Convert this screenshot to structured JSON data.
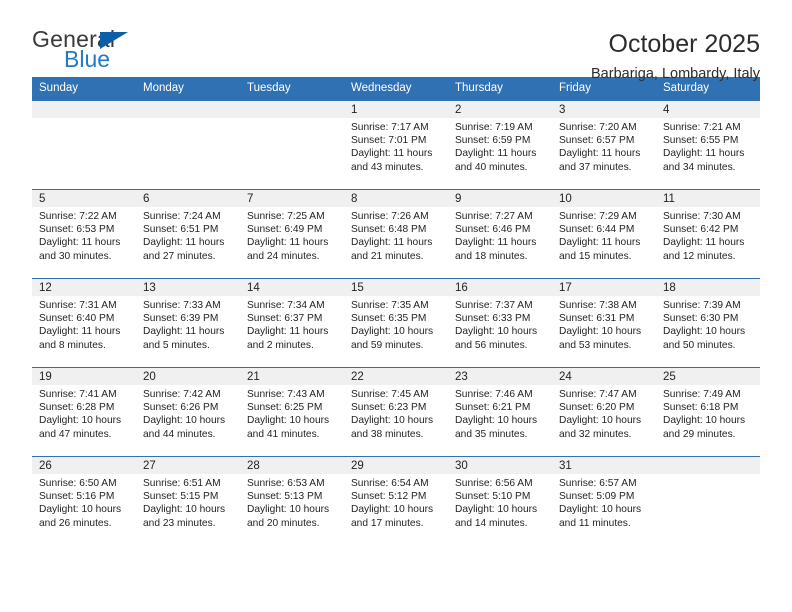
{
  "brand": {
    "name_part1": "General",
    "name_part2": "Blue",
    "triangle_icon": "triangle-icon",
    "accent_color": "#1f7ac8",
    "triangle_color": "#0b5ea8"
  },
  "header": {
    "title": "October 2025",
    "subtitle": "Barbariga, Lombardy, Italy"
  },
  "colors": {
    "header_blue": "#3071b4",
    "daynum_bg": "#f0f0f0",
    "text": "#231f20"
  },
  "weekday_headers": [
    "Sunday",
    "Monday",
    "Tuesday",
    "Wednesday",
    "Thursday",
    "Friday",
    "Saturday"
  ],
  "labels": {
    "sunrise_prefix": "Sunrise: ",
    "sunset_prefix": "Sunset: ",
    "daylight_prefix": "Daylight: "
  },
  "weeks": [
    [
      {
        "day": "",
        "empty": true
      },
      {
        "day": "",
        "empty": true
      },
      {
        "day": "",
        "empty": true
      },
      {
        "day": "1",
        "sunrise": "Sunrise: 7:17 AM",
        "sunset": "Sunset: 7:01 PM",
        "daylight_line1": "Daylight: 11 hours",
        "daylight_line2": "and 43 minutes."
      },
      {
        "day": "2",
        "sunrise": "Sunrise: 7:19 AM",
        "sunset": "Sunset: 6:59 PM",
        "daylight_line1": "Daylight: 11 hours",
        "daylight_line2": "and 40 minutes."
      },
      {
        "day": "3",
        "sunrise": "Sunrise: 7:20 AM",
        "sunset": "Sunset: 6:57 PM",
        "daylight_line1": "Daylight: 11 hours",
        "daylight_line2": "and 37 minutes."
      },
      {
        "day": "4",
        "sunrise": "Sunrise: 7:21 AM",
        "sunset": "Sunset: 6:55 PM",
        "daylight_line1": "Daylight: 11 hours",
        "daylight_line2": "and 34 minutes."
      }
    ],
    [
      {
        "day": "5",
        "sunrise": "Sunrise: 7:22 AM",
        "sunset": "Sunset: 6:53 PM",
        "daylight_line1": "Daylight: 11 hours",
        "daylight_line2": "and 30 minutes."
      },
      {
        "day": "6",
        "sunrise": "Sunrise: 7:24 AM",
        "sunset": "Sunset: 6:51 PM",
        "daylight_line1": "Daylight: 11 hours",
        "daylight_line2": "and 27 minutes."
      },
      {
        "day": "7",
        "sunrise": "Sunrise: 7:25 AM",
        "sunset": "Sunset: 6:49 PM",
        "daylight_line1": "Daylight: 11 hours",
        "daylight_line2": "and 24 minutes."
      },
      {
        "day": "8",
        "sunrise": "Sunrise: 7:26 AM",
        "sunset": "Sunset: 6:48 PM",
        "daylight_line1": "Daylight: 11 hours",
        "daylight_line2": "and 21 minutes."
      },
      {
        "day": "9",
        "sunrise": "Sunrise: 7:27 AM",
        "sunset": "Sunset: 6:46 PM",
        "daylight_line1": "Daylight: 11 hours",
        "daylight_line2": "and 18 minutes."
      },
      {
        "day": "10",
        "sunrise": "Sunrise: 7:29 AM",
        "sunset": "Sunset: 6:44 PM",
        "daylight_line1": "Daylight: 11 hours",
        "daylight_line2": "and 15 minutes."
      },
      {
        "day": "11",
        "sunrise": "Sunrise: 7:30 AM",
        "sunset": "Sunset: 6:42 PM",
        "daylight_line1": "Daylight: 11 hours",
        "daylight_line2": "and 12 minutes."
      }
    ],
    [
      {
        "day": "12",
        "sunrise": "Sunrise: 7:31 AM",
        "sunset": "Sunset: 6:40 PM",
        "daylight_line1": "Daylight: 11 hours",
        "daylight_line2": "and 8 minutes."
      },
      {
        "day": "13",
        "sunrise": "Sunrise: 7:33 AM",
        "sunset": "Sunset: 6:39 PM",
        "daylight_line1": "Daylight: 11 hours",
        "daylight_line2": "and 5 minutes."
      },
      {
        "day": "14",
        "sunrise": "Sunrise: 7:34 AM",
        "sunset": "Sunset: 6:37 PM",
        "daylight_line1": "Daylight: 11 hours",
        "daylight_line2": "and 2 minutes."
      },
      {
        "day": "15",
        "sunrise": "Sunrise: 7:35 AM",
        "sunset": "Sunset: 6:35 PM",
        "daylight_line1": "Daylight: 10 hours",
        "daylight_line2": "and 59 minutes."
      },
      {
        "day": "16",
        "sunrise": "Sunrise: 7:37 AM",
        "sunset": "Sunset: 6:33 PM",
        "daylight_line1": "Daylight: 10 hours",
        "daylight_line2": "and 56 minutes."
      },
      {
        "day": "17",
        "sunrise": "Sunrise: 7:38 AM",
        "sunset": "Sunset: 6:31 PM",
        "daylight_line1": "Daylight: 10 hours",
        "daylight_line2": "and 53 minutes."
      },
      {
        "day": "18",
        "sunrise": "Sunrise: 7:39 AM",
        "sunset": "Sunset: 6:30 PM",
        "daylight_line1": "Daylight: 10 hours",
        "daylight_line2": "and 50 minutes."
      }
    ],
    [
      {
        "day": "19",
        "sunrise": "Sunrise: 7:41 AM",
        "sunset": "Sunset: 6:28 PM",
        "daylight_line1": "Daylight: 10 hours",
        "daylight_line2": "and 47 minutes."
      },
      {
        "day": "20",
        "sunrise": "Sunrise: 7:42 AM",
        "sunset": "Sunset: 6:26 PM",
        "daylight_line1": "Daylight: 10 hours",
        "daylight_line2": "and 44 minutes."
      },
      {
        "day": "21",
        "sunrise": "Sunrise: 7:43 AM",
        "sunset": "Sunset: 6:25 PM",
        "daylight_line1": "Daylight: 10 hours",
        "daylight_line2": "and 41 minutes."
      },
      {
        "day": "22",
        "sunrise": "Sunrise: 7:45 AM",
        "sunset": "Sunset: 6:23 PM",
        "daylight_line1": "Daylight: 10 hours",
        "daylight_line2": "and 38 minutes."
      },
      {
        "day": "23",
        "sunrise": "Sunrise: 7:46 AM",
        "sunset": "Sunset: 6:21 PM",
        "daylight_line1": "Daylight: 10 hours",
        "daylight_line2": "and 35 minutes."
      },
      {
        "day": "24",
        "sunrise": "Sunrise: 7:47 AM",
        "sunset": "Sunset: 6:20 PM",
        "daylight_line1": "Daylight: 10 hours",
        "daylight_line2": "and 32 minutes."
      },
      {
        "day": "25",
        "sunrise": "Sunrise: 7:49 AM",
        "sunset": "Sunset: 6:18 PM",
        "daylight_line1": "Daylight: 10 hours",
        "daylight_line2": "and 29 minutes."
      }
    ],
    [
      {
        "day": "26",
        "sunrise": "Sunrise: 6:50 AM",
        "sunset": "Sunset: 5:16 PM",
        "daylight_line1": "Daylight: 10 hours",
        "daylight_line2": "and 26 minutes."
      },
      {
        "day": "27",
        "sunrise": "Sunrise: 6:51 AM",
        "sunset": "Sunset: 5:15 PM",
        "daylight_line1": "Daylight: 10 hours",
        "daylight_line2": "and 23 minutes."
      },
      {
        "day": "28",
        "sunrise": "Sunrise: 6:53 AM",
        "sunset": "Sunset: 5:13 PM",
        "daylight_line1": "Daylight: 10 hours",
        "daylight_line2": "and 20 minutes."
      },
      {
        "day": "29",
        "sunrise": "Sunrise: 6:54 AM",
        "sunset": "Sunset: 5:12 PM",
        "daylight_line1": "Daylight: 10 hours",
        "daylight_line2": "and 17 minutes."
      },
      {
        "day": "30",
        "sunrise": "Sunrise: 6:56 AM",
        "sunset": "Sunset: 5:10 PM",
        "daylight_line1": "Daylight: 10 hours",
        "daylight_line2": "and 14 minutes."
      },
      {
        "day": "31",
        "sunrise": "Sunrise: 6:57 AM",
        "sunset": "Sunset: 5:09 PM",
        "daylight_line1": "Daylight: 10 hours",
        "daylight_line2": "and 11 minutes."
      },
      {
        "day": "",
        "empty": true
      }
    ]
  ]
}
